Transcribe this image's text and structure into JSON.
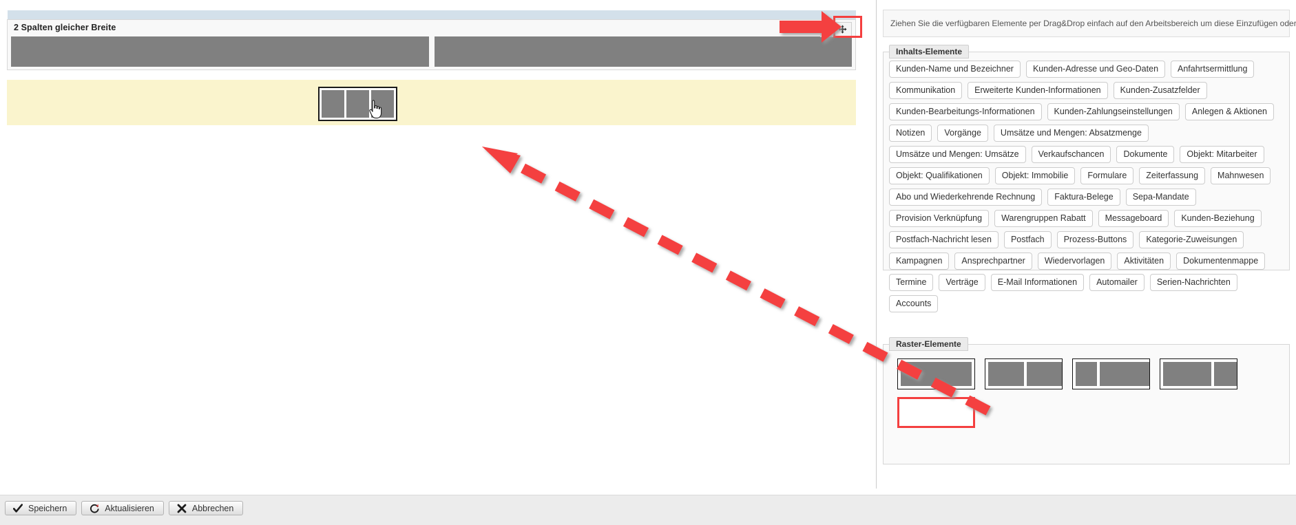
{
  "workspace": {
    "panel": {
      "title": "2 Spalten gleicher Breite",
      "columns": 2,
      "toolbar": {
        "delete_icon": "trash-icon",
        "move_icon": "move-icon"
      }
    },
    "dropzone": {
      "ghost_columns": 3,
      "cursor_icon": "hand-pointer-cursor"
    }
  },
  "sidebar": {
    "hint": "Ziehen Sie die verfügbaren Elemente per Drag&Drop einfach auf den Arbeitsbereich um diese Einzufügen oder zu verschieben.",
    "content_elements": {
      "legend": "Inhalts-Elemente",
      "items": [
        "Kunden-Name und Bezeichner",
        "Kunden-Adresse und Geo-Daten",
        "Anfahrtsermittlung",
        "Kommunikation",
        "Erweiterte Kunden-Informationen",
        "Kunden-Zusatzfelder",
        "Kunden-Bearbeitungs-Informationen",
        "Kunden-Zahlungseinstellungen",
        "Anlegen & Aktionen",
        "Notizen",
        "Vorgänge",
        "Umsätze und Mengen: Absatzmenge",
        "Umsätze und Mengen: Umsätze",
        "Verkaufschancen",
        "Dokumente",
        "Objekt: Mitarbeiter",
        "Objekt: Qualifikationen",
        "Objekt: Immobilie",
        "Formulare",
        "Zeiterfassung",
        "Mahnwesen",
        "Abo und Wiederkehrende Rechnung",
        "Faktura-Belege",
        "Sepa-Mandate",
        "Provision Verknüpfung",
        "Warengruppen Rabatt",
        "Messageboard",
        "Kunden-Beziehung",
        "Postfach-Nachricht lesen",
        "Postfach",
        "Prozess-Buttons",
        "Kategorie-Zuweisungen",
        "Kampagnen",
        "Ansprechpartner",
        "Wiedervorlagen",
        "Aktivitäten",
        "Dokumentenmappe",
        "Termine",
        "Verträge",
        "E-Mail Informationen",
        "Automailer",
        "Serien-Nachrichten",
        "Accounts"
      ]
    },
    "raster_elements": {
      "legend": "Raster-Elemente",
      "tiles": [
        {
          "name": "one-column",
          "widths": [
            100
          ],
          "highlighted": false
        },
        {
          "name": "two-equal-columns",
          "widths": [
            50,
            50
          ],
          "highlighted": false
        },
        {
          "name": "narrow-wide-columns",
          "widths": [
            30,
            70
          ],
          "highlighted": false
        },
        {
          "name": "wide-narrow-columns",
          "widths": [
            68,
            32
          ],
          "highlighted": false
        },
        {
          "name": "empty-placeholder",
          "widths": [],
          "highlighted": true
        }
      ]
    }
  },
  "footer": {
    "buttons": [
      {
        "label": "Speichern",
        "icon": "check-icon"
      },
      {
        "label": "Aktualisieren",
        "icon": "refresh-icon"
      },
      {
        "label": "Abbrechen",
        "icon": "close-x-icon"
      }
    ]
  },
  "colors": {
    "accent_red": "#f43f3f",
    "dropzone_yellow": "#faf4cd",
    "strip_blue": "#d3e0ea",
    "column_grey": "#808080"
  }
}
